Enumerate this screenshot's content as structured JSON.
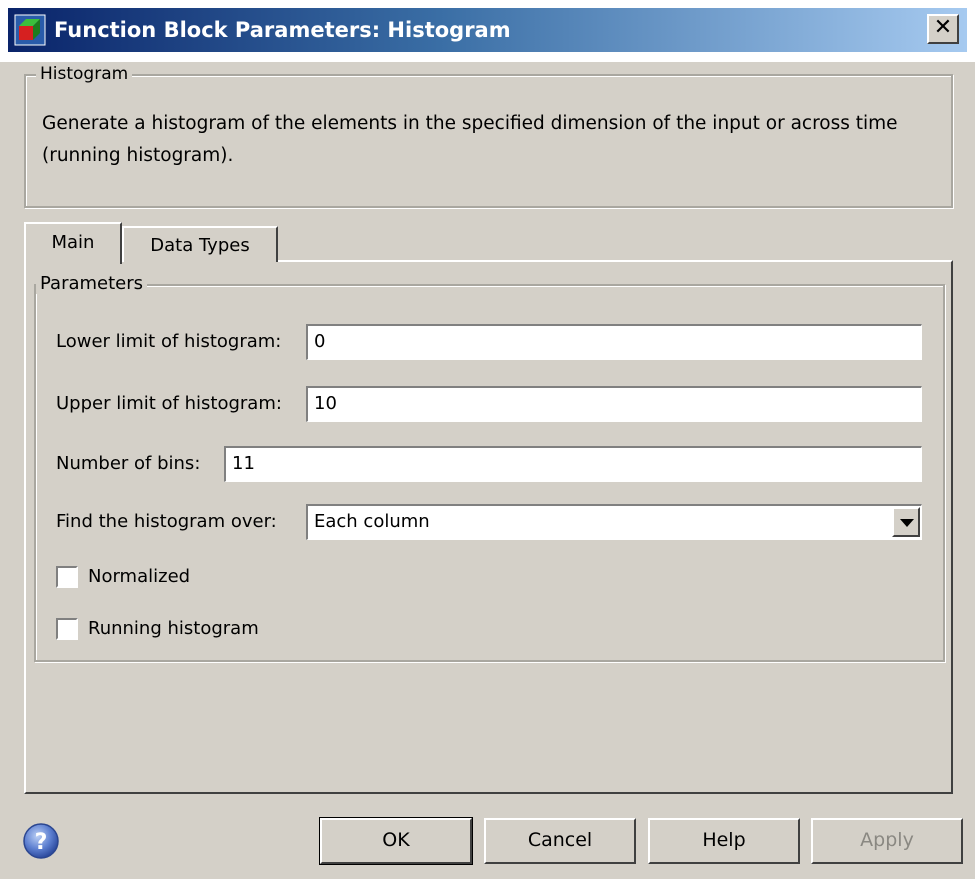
{
  "window": {
    "title": "Function Block Parameters: Histogram",
    "close_glyph": "✕",
    "icon": "simulink-block-icon"
  },
  "description_group": {
    "label": "Histogram",
    "text": "Generate a histogram of the elements in the specified dimension of the input or across time (running histogram)."
  },
  "tabs": [
    {
      "label": "Main",
      "selected": true
    },
    {
      "label": "Data Types",
      "selected": false
    }
  ],
  "parameters": {
    "group_label": "Parameters",
    "lower_limit": {
      "label": "Lower limit of histogram:",
      "value": "0"
    },
    "upper_limit": {
      "label": "Upper limit of histogram:",
      "value": "10"
    },
    "num_bins": {
      "label": "Number of bins:",
      "value": "11"
    },
    "find_over": {
      "label": "Find the histogram over:",
      "value": "Each column"
    },
    "normalized": {
      "label": "Normalized",
      "checked": false
    },
    "running": {
      "label": "Running histogram",
      "checked": false
    }
  },
  "buttons": {
    "ok": "OK",
    "cancel": "Cancel",
    "help": "Help",
    "apply": "Apply"
  },
  "colors": {
    "titlebar_start": "#0a246a",
    "titlebar_end": "#a6caf0",
    "dialog_bg": "#d4d0c8",
    "disabled_text": "#8a8882"
  }
}
